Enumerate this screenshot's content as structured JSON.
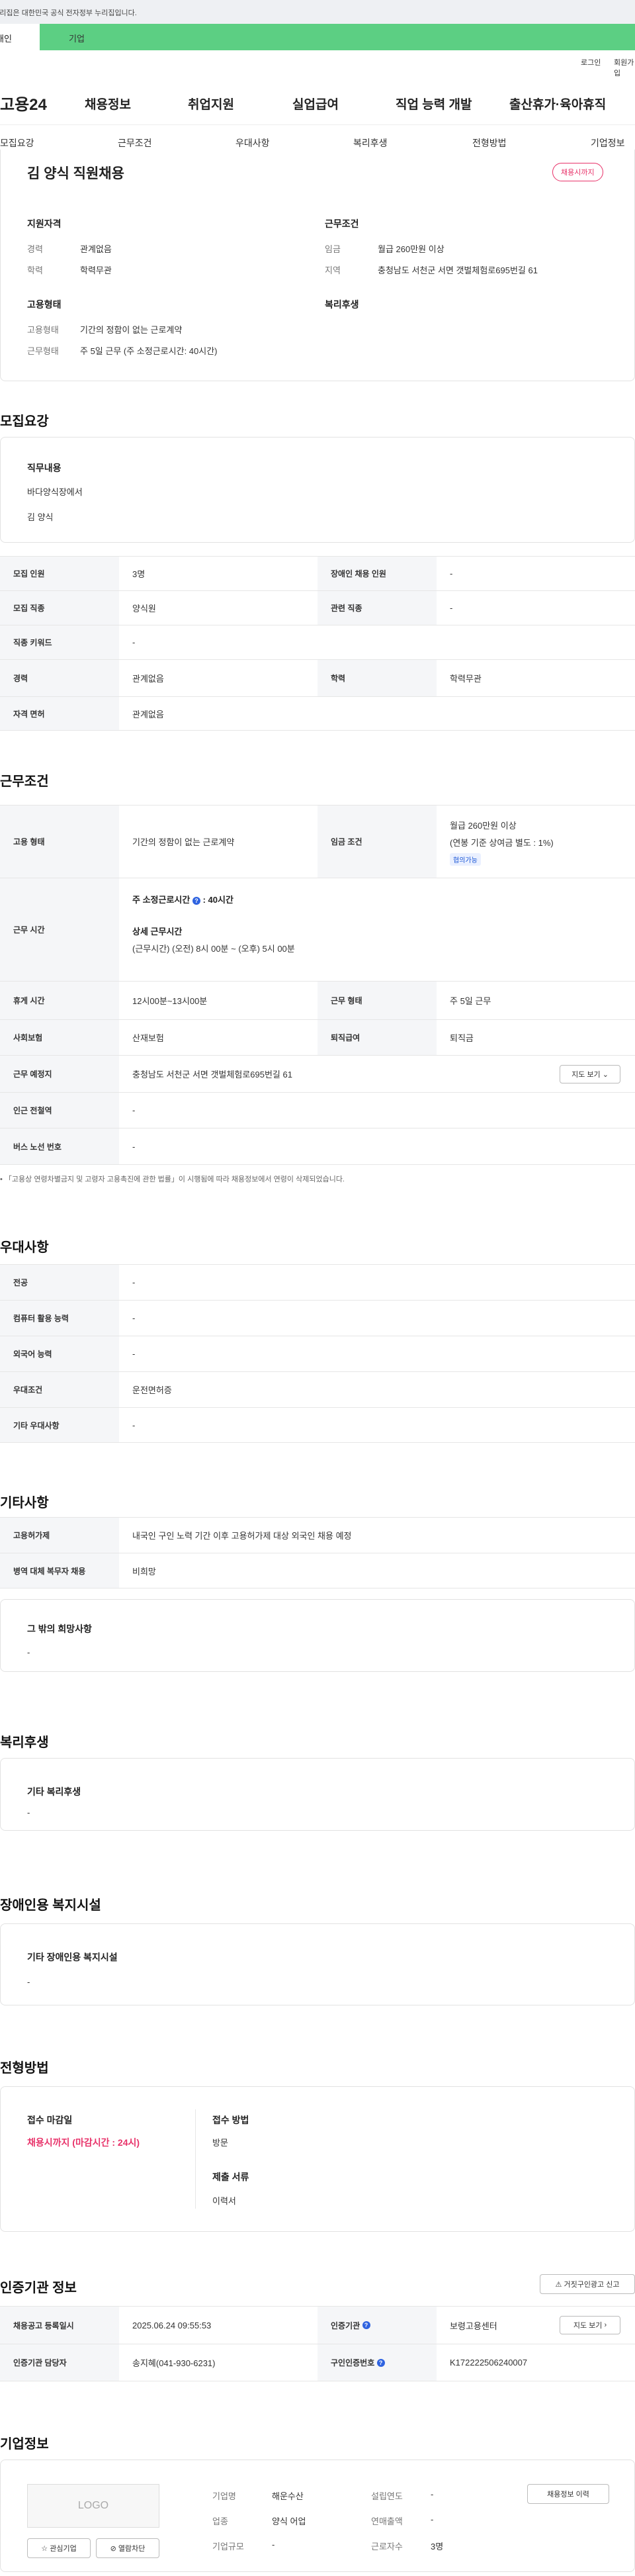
{
  "gov_banner": "이 누리집은 대한민국 공식 전자정부 누리집입니다.",
  "user_tabs": [
    "개인",
    "기업"
  ],
  "util_links": [
    "로그인",
    "회원가입"
  ],
  "logo": "고용24",
  "gnb": [
    "채용정보",
    "취업지원",
    "실업급여",
    "직업 능력 개발",
    "출산휴가·육아휴직"
  ],
  "subnav": [
    "모집요강",
    "근무조건",
    "우대사항",
    "복리후생",
    "전형방법",
    "기업정보"
  ],
  "header": {
    "title": "김 양식 직원채용",
    "status": "채용시까지"
  },
  "summary": {
    "qual_title": "지원자격",
    "career_label": "경력",
    "career": "관계없음",
    "edu_label": "학력",
    "edu": "학력무관",
    "emp_title": "고용형태",
    "emp_label": "고용형태",
    "emp": "기간의 정함이 없는 근로계약",
    "hours_label": "근무형태",
    "hours": "주 5일 근무 (주 소정근로시간: 40시간)",
    "cond_title": "근무조건",
    "wage_label": "임금",
    "wage": "월급 260만원 이상",
    "area_label": "지역",
    "area": "충청남도 서천군 서면 갯벌체험로695번길 61",
    "welfare_title": "복리후생"
  },
  "recruit": {
    "title": "모집요강",
    "job_title": "직무내용",
    "job_lines": [
      "바다양식장에서",
      "김 양식"
    ],
    "rows": [
      [
        "모집 인원",
        "3명",
        "장애인 채용 인원",
        "-"
      ],
      [
        "모집 직종",
        "양식원",
        "관련 직종",
        "-"
      ],
      [
        "직종 키워드",
        "-"
      ],
      [
        "경력",
        "관계없음",
        "학력",
        "학력무관"
      ],
      [
        "자격 면허",
        "관계없음"
      ]
    ]
  },
  "work": {
    "title": "근무조건",
    "emp_label": "고용 형태",
    "emp": "기간의 정함이 없는 근로계약",
    "wage_label": "임금 조건",
    "wage1": "월급 260만원 이상",
    "wage2": "(연봉 기준 상여금 별도 : 1%)",
    "nego": "협의가능",
    "time_label": "근무 시간",
    "std_hours": "주 소정근로시간",
    "std_val": ": 40시간",
    "detail_title": "상세 근무시간",
    "detail": "(근무시간) (오전) 8시 00분 ~ (오후) 5시 00분",
    "rows": [
      [
        "휴게 시간",
        "12시00분~13시00분",
        "근무 형태",
        "주 5일 근무"
      ],
      [
        "사회보험",
        "산재보험",
        "퇴직급여",
        "퇴직금"
      ],
      [
        "근무 예정지",
        "충청남도 서천군 서면 갯벌체험로695번길 61"
      ],
      [
        "인근 전철역",
        "-"
      ],
      [
        "버스 노선 번호",
        "-"
      ]
    ],
    "map_btn": "지도 보기",
    "notice": "「고용상 연령차별금지 및 고령자 고용촉진에 관한 법률」이 시행됨에 따라 채용정보에서 연령이 삭제되었습니다."
  },
  "pref": {
    "title": "우대사항",
    "rows": [
      [
        "전공",
        "-"
      ],
      [
        "컴퓨터 활용 능력",
        "-"
      ],
      [
        "외국어 능력",
        "-"
      ],
      [
        "우대조건",
        "운전면허증"
      ],
      [
        "기타 우대사항",
        "-"
      ]
    ]
  },
  "etc": {
    "title": "기타사항",
    "rows": [
      [
        "고용허가제",
        "내국인 구인 노력 기간 이후 고용허가제 대상 외국인 채용 예정"
      ],
      [
        "병역 대체 복무자 채용",
        "비희망"
      ]
    ],
    "other_title": "그 밖의 희망사항",
    "other": "-"
  },
  "welfare": {
    "title": "복리후생",
    "box_title": "기타 복리후생",
    "box_val": "-"
  },
  "disability": {
    "title": "장애인용 복지시설",
    "box_title": "기타 장애인용 복지시설",
    "box_val": "-"
  },
  "process": {
    "title": "전형방법",
    "deadline_title": "접수 마감일",
    "deadline": "채용시까지 (마감시간 : 24시)",
    "method_title": "접수 방법",
    "method": "방문",
    "docs_title": "제출 서류",
    "docs": "이력서"
  },
  "cert": {
    "title": "인증기관 정보",
    "report_btn": "거짓구인광고 신고",
    "rows": [
      [
        "채용공고 등록일시",
        "2025.06.24 09:55:53",
        "인증기관",
        "보령고용센터"
      ],
      [
        "인증기관 담당자",
        "송지혜(041-930-6231)",
        "구인인증번호",
        "K172222506240007"
      ]
    ],
    "map_btn": "지도 보기"
  },
  "company": {
    "title": "기업정보",
    "logo": "LOGO",
    "fav_btn": "관심기업",
    "block_btn": "열람차단",
    "history_btn": "채용정보 이력",
    "rows": [
      [
        "기업명",
        "해운수산",
        "설립연도",
        "-"
      ],
      [
        "업종",
        "양식 어업",
        "연매출액",
        "-"
      ],
      [
        "기업규모",
        "-",
        "근로자수",
        "3명"
      ]
    ]
  }
}
